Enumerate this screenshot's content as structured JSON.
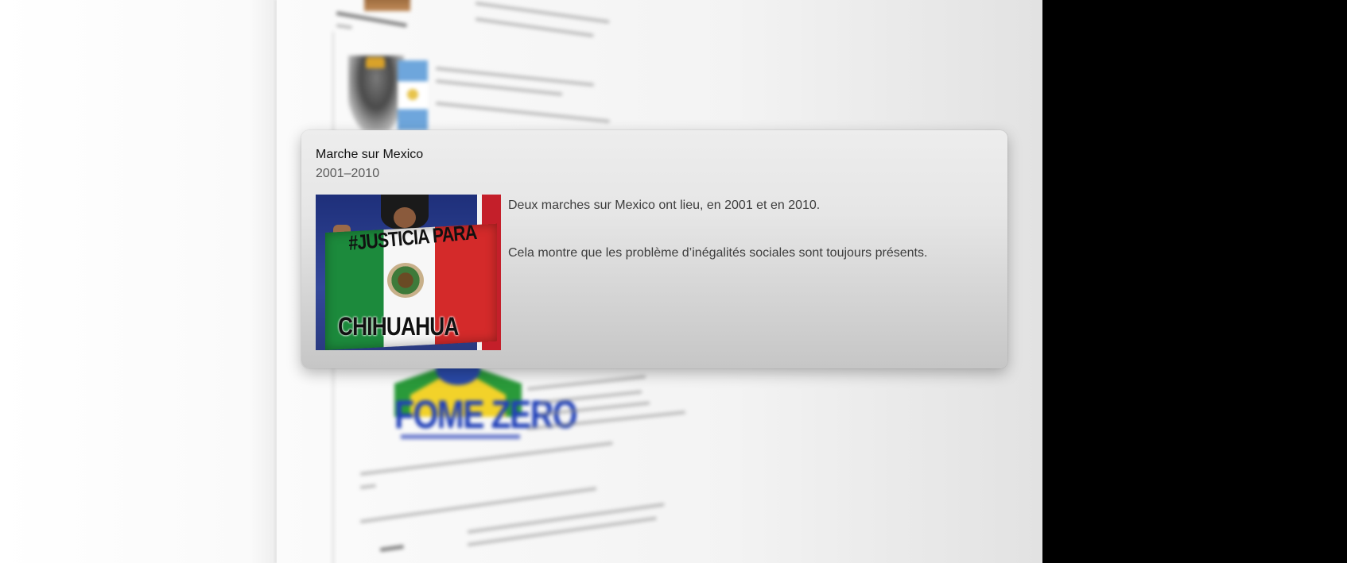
{
  "popover": {
    "title": "Marche sur Mexico",
    "dates": "2001–2010",
    "description_line1": "Deux marches sur Mexico ont lieu, en 2001 et en 2010.",
    "description_line2": "Cela montre que les problème d’inégalités sociales sont toujours présents.",
    "image": {
      "caption_top": "#JUSTICIA PARA",
      "caption_bottom": "CHIHUAHUA"
    }
  },
  "background_document": {
    "logo_text": "FOME ZERO"
  },
  "colors": {
    "card_bg": "#e6e6e6",
    "title": "#111111",
    "dates": "#5a5a5a",
    "body_text": "#3d3d3d",
    "flag_green": "#1c8a3c",
    "flag_red": "#d42a2a",
    "fome_blue": "#2040b8"
  }
}
